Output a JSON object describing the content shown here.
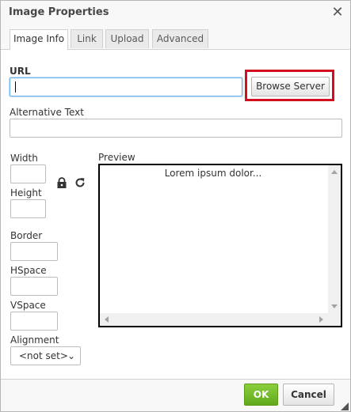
{
  "dialog": {
    "title": "Image Properties",
    "close_icon": "close-icon"
  },
  "tabs": [
    {
      "label": "Image Info",
      "active": true
    },
    {
      "label": "Link",
      "active": false
    },
    {
      "label": "Upload",
      "active": false
    },
    {
      "label": "Advanced",
      "active": false
    }
  ],
  "url": {
    "label": "URL",
    "value": "",
    "browse_label": "Browse Server"
  },
  "alt_text": {
    "label": "Alternative Text",
    "value": ""
  },
  "dimensions": {
    "width_label": "Width",
    "width_value": "",
    "height_label": "Height",
    "height_value": "",
    "lock_icon": "lock-icon",
    "reset_icon": "reset-size-icon"
  },
  "spacing": {
    "border_label": "Border",
    "border_value": "",
    "hspace_label": "HSpace",
    "hspace_value": "",
    "vspace_label": "VSpace",
    "vspace_value": ""
  },
  "alignment": {
    "label": "Alignment",
    "selected": "<not set>"
  },
  "preview": {
    "label": "Preview",
    "text": "Lorem ipsum dolor..."
  },
  "footer": {
    "ok_label": "OK",
    "cancel_label": "Cancel"
  },
  "colors": {
    "highlight": "#d1101f",
    "ok_button": "#6cb626"
  }
}
